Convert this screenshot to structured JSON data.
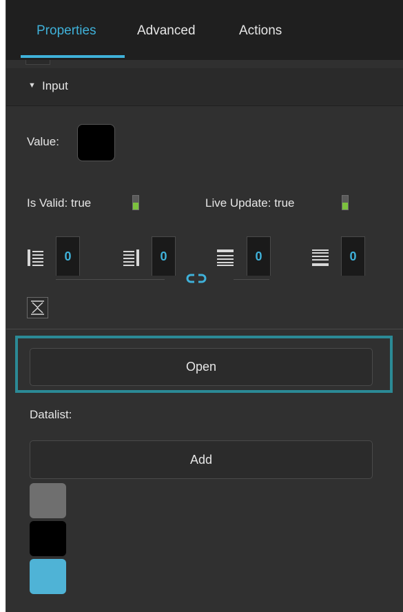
{
  "tabs": [
    {
      "label": "Properties",
      "active": true
    },
    {
      "label": "Advanced",
      "active": false
    },
    {
      "label": "Actions",
      "active": false
    }
  ],
  "section": {
    "title": "Input",
    "expanded": true
  },
  "value": {
    "label": "Value:",
    "color": "#000000"
  },
  "is_valid": {
    "label": "Is Valid:",
    "value": "true"
  },
  "live_update": {
    "label": "Live Update:",
    "value": "true"
  },
  "padding": {
    "left": "0",
    "right": "0",
    "top": "0",
    "bottom": "0",
    "linked": true
  },
  "open_button": {
    "label": "Open"
  },
  "datalist": {
    "label": "Datalist:",
    "add_label": "Add",
    "swatches": [
      "#6f6f6f",
      "#000000",
      "#4fb3d6"
    ]
  },
  "colors": {
    "accent": "#3fb1d9",
    "focus_ring": "#2b8a96",
    "toggle_on": "#7cc23e",
    "panel_bg": "#303030",
    "tabbar_bg": "#1f1f1f"
  }
}
